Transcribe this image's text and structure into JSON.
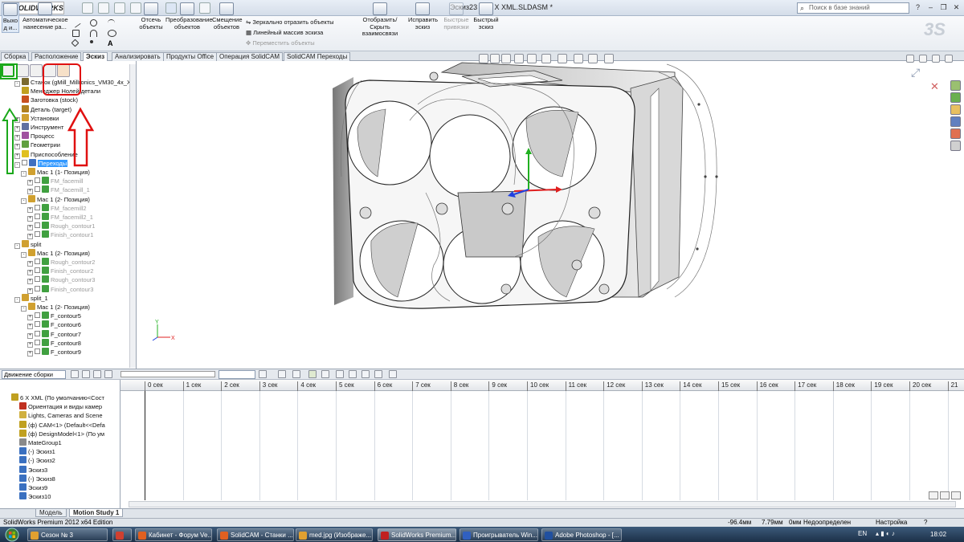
{
  "app": {
    "brand": "SOLIDWORKS",
    "document_title": "Эскиз23 от 6 X XML.SLDASM *",
    "search_placeholder": "Поиск в базе знаний"
  },
  "ribbon": {
    "exit_label": "Выхо д и...",
    "auto_dim_label": "Автоматическое нанесение ра...",
    "trim_label": "Отсечь объекты",
    "convert_label": "Преобразование объектов",
    "offset_label": "Смещение объектов",
    "mirror_label": "Зеркально отразить объекты",
    "linear_pattern_label": "Линейный массив эскиза",
    "move_label": "Переместить объекты",
    "display_relations_label": "Отобразить/Скрыть взаимосвязи",
    "repair_label": "Исправить эскиз",
    "quick_snaps_label": "Быстрые привязки",
    "rapid_sketch_label": "Быстрый эскиз"
  },
  "tabs": [
    "Сборка",
    "Расположение",
    "Эскиз",
    "Анализировать",
    "Продукты Office",
    "Операция SolidCAM",
    "SolidCAM Переходы"
  ],
  "active_tab": "Эскиз",
  "tree": [
    {
      "label": "Станок (gMill_Millronics_VM30_4x_Xr",
      "indent": 1,
      "exp": "-",
      "color": "#7a6a30",
      "cb": false,
      "dim": false
    },
    {
      "label": "Менеджер Нолей детали",
      "indent": 1,
      "exp": "",
      "color": "#c0a020",
      "cb": false,
      "dim": false
    },
    {
      "label": "Заготовка (stock)",
      "indent": 1,
      "exp": "",
      "color": "#c85020",
      "cb": false,
      "dim": false
    },
    {
      "label": "Деталь (target)",
      "indent": 1,
      "exp": "",
      "color": "#b08020",
      "cb": false,
      "dim": false
    },
    {
      "label": "Установки",
      "indent": 1,
      "exp": "+",
      "color": "#d0a030",
      "cb": false,
      "dim": false
    },
    {
      "label": "Инструмент",
      "indent": 1,
      "exp": "+",
      "color": "#6070a0",
      "cb": false,
      "dim": false
    },
    {
      "label": "Процесс",
      "indent": 1,
      "exp": "+",
      "color": "#a050a0",
      "cb": false,
      "dim": false
    },
    {
      "label": "Геометрии",
      "indent": 1,
      "exp": "+",
      "color": "#60a040",
      "cb": false,
      "dim": false
    },
    {
      "label": "Приспособление",
      "indent": 1,
      "exp": "+",
      "color": "#e0c020",
      "cb": false,
      "dim": false
    },
    {
      "label": "Переходы",
      "indent": 1,
      "exp": "-",
      "color": "#4070c0",
      "cb": true,
      "dim": false,
      "sel": true
    },
    {
      "label": "Mac 1 (1- Позиция)",
      "indent": 2,
      "exp": "-",
      "color": "#d0a030",
      "cb": false,
      "dim": false
    },
    {
      "label": "FM_facemill",
      "indent": 3,
      "exp": "+",
      "color": "#40a040",
      "cb": true,
      "dim": true
    },
    {
      "label": "FM_facemill_1",
      "indent": 3,
      "exp": "+",
      "color": "#40a040",
      "cb": true,
      "dim": true
    },
    {
      "label": "Mac 1 (2- Позиция)",
      "indent": 2,
      "exp": "-",
      "color": "#d0a030",
      "cb": false,
      "dim": false
    },
    {
      "label": "FM_facemill2",
      "indent": 3,
      "exp": "+",
      "color": "#40a040",
      "cb": true,
      "dim": true
    },
    {
      "label": "FM_facemill2_1",
      "indent": 3,
      "exp": "+",
      "color": "#40a040",
      "cb": true,
      "dim": true
    },
    {
      "label": "Rough_contour1",
      "indent": 3,
      "exp": "+",
      "color": "#40a040",
      "cb": true,
      "dim": true
    },
    {
      "label": "Finish_contour1",
      "indent": 3,
      "exp": "+",
      "color": "#40a040",
      "cb": true,
      "dim": true
    },
    {
      "label": "split",
      "indent": 1,
      "exp": "-",
      "color": "#d0a030",
      "cb": false,
      "dim": false
    },
    {
      "label": "Mac 1 (2- Позиция)",
      "indent": 2,
      "exp": "-",
      "color": "#d0a030",
      "cb": false,
      "dim": false
    },
    {
      "label": "Rough_contour2",
      "indent": 3,
      "exp": "+",
      "color": "#40a040",
      "cb": true,
      "dim": true
    },
    {
      "label": "Finish_contour2",
      "indent": 3,
      "exp": "+",
      "color": "#40a040",
      "cb": true,
      "dim": true
    },
    {
      "label": "Rough_contour3",
      "indent": 3,
      "exp": "+",
      "color": "#40a040",
      "cb": true,
      "dim": true
    },
    {
      "label": "Finish_contour3",
      "indent": 3,
      "exp": "+",
      "color": "#40a040",
      "cb": true,
      "dim": true
    },
    {
      "label": "split_1",
      "indent": 1,
      "exp": "-",
      "color": "#d0a030",
      "cb": false,
      "dim": false
    },
    {
      "label": "Mac 1 (2- Позиция)",
      "indent": 2,
      "exp": "-",
      "color": "#d0a030",
      "cb": false,
      "dim": false
    },
    {
      "label": "F_contour5",
      "indent": 3,
      "exp": "+",
      "color": "#40a040",
      "cb": true,
      "dim": false
    },
    {
      "label": "F_contour6",
      "indent": 3,
      "exp": "+",
      "color": "#40a040",
      "cb": true,
      "dim": false
    },
    {
      "label": "F_contour7",
      "indent": 3,
      "exp": "+",
      "color": "#40a040",
      "cb": true,
      "dim": false
    },
    {
      "label": "F_contour8",
      "indent": 3,
      "exp": "+",
      "color": "#40a040",
      "cb": true,
      "dim": false
    },
    {
      "label": "F_contour9",
      "indent": 3,
      "exp": "+",
      "color": "#40a040",
      "cb": true,
      "dim": false
    }
  ],
  "motion": {
    "study_type": "Движение сборки",
    "time_labels": [
      "0 сек",
      "1 сек",
      "2 сек",
      "3 сек",
      "4 сек",
      "5 сек",
      "6 сек",
      "7 сек",
      "8 сек",
      "9 сек",
      "10 сек",
      "11 сек",
      "12 сек",
      "13 сек",
      "14 сек",
      "15 сек",
      "16 сек",
      "17 сек",
      "18 сек",
      "19 сек",
      "20 сек",
      "21"
    ],
    "tree": [
      {
        "label": "6 X XML  (По умолчанию<Сост",
        "color": "#c0a020",
        "indent": 0
      },
      {
        "label": "Ориентация и виды камер",
        "color": "#c03020",
        "indent": 1
      },
      {
        "label": "Lights, Cameras and Scene",
        "color": "#d0b040",
        "indent": 1
      },
      {
        "label": "(ф) CAM<1> (Default<<Defa",
        "color": "#c0a020",
        "indent": 1
      },
      {
        "label": "(ф) DesignModel<1> (По ум",
        "color": "#c0a020",
        "indent": 1
      },
      {
        "label": "MateGroup1",
        "color": "#8a8a8a",
        "indent": 1
      },
      {
        "label": "(-) Эскиз1",
        "color": "#3a70c0",
        "indent": 1
      },
      {
        "label": "(-) Эскиз2",
        "color": "#3a70c0",
        "indent": 1
      },
      {
        "label": "Эскиз3",
        "color": "#3a70c0",
        "indent": 1
      },
      {
        "label": "(-) Эскиз8",
        "color": "#3a70c0",
        "indent": 1
      },
      {
        "label": "Эскиз9",
        "color": "#3a70c0",
        "indent": 1
      },
      {
        "label": "Эскиз10",
        "color": "#3a70c0",
        "indent": 1
      }
    ],
    "tabs": [
      "Модель",
      "Motion Study 1"
    ],
    "active_tab": "Motion Study 1"
  },
  "status": {
    "edition": "SolidWorks Premium 2012 x64 Edition",
    "x": "-96.4мм",
    "y": "7.79мм",
    "z": "0мм",
    "state": "Недоопределен",
    "settings": "Настройка",
    "help": "?"
  },
  "taskbar": {
    "items": [
      {
        "label": "Сезон № 3",
        "color": "#e0a030"
      },
      {
        "label": "",
        "color": "#d04030"
      },
      {
        "label": "Кабинет - Форум Ve...",
        "color": "#e06020"
      },
      {
        "label": "SolidCAM - Станки ...",
        "color": "#e06020"
      },
      {
        "label": "med.jpg (Изображе...",
        "color": "#e0a030"
      },
      {
        "label": "SolidWorks Premium...",
        "color": "#c02020",
        "active": true
      },
      {
        "label": "Проигрыватель Win...",
        "color": "#3060c0"
      },
      {
        "label": "Adobe Photoshop - [...",
        "color": "#2050a0"
      }
    ],
    "lang": "EN",
    "clock": "18:02"
  },
  "colors": {
    "selection": "#3399ff",
    "annotation_green": "#1aa81a",
    "annotation_red": "#e01010",
    "axis_x": "#e02020",
    "axis_y": "#20b020",
    "axis_z": "#2040e0"
  }
}
